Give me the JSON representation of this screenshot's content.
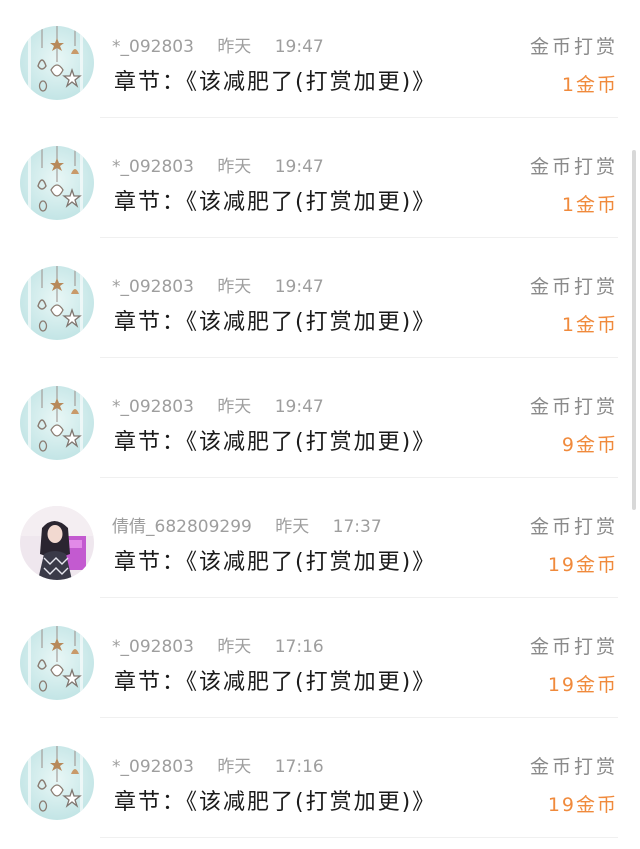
{
  "colors": {
    "amount": "#f08a3c",
    "meta": "#9e9e9e",
    "text": "#1a1a1a"
  },
  "rewards": [
    {
      "avatar": "star-bell-avatar",
      "username": "*_092803",
      "day": "昨天",
      "time": "19:47",
      "chapter_prefix": "章节：",
      "chapter_title": "《该减肥了(打赏加更)》",
      "reward_label": "金币打赏",
      "amount": "1金币"
    },
    {
      "avatar": "star-bell-avatar",
      "username": "*_092803",
      "day": "昨天",
      "time": "19:47",
      "chapter_prefix": "章节：",
      "chapter_title": "《该减肥了(打赏加更)》",
      "reward_label": "金币打赏",
      "amount": "1金币"
    },
    {
      "avatar": "star-bell-avatar",
      "username": "*_092803",
      "day": "昨天",
      "time": "19:47",
      "chapter_prefix": "章节：",
      "chapter_title": "《该减肥了(打赏加更)》",
      "reward_label": "金币打赏",
      "amount": "1金币"
    },
    {
      "avatar": "star-bell-avatar",
      "username": "*_092803",
      "day": "昨天",
      "time": "19:47",
      "chapter_prefix": "章节：",
      "chapter_title": "《该减肥了(打赏加更)》",
      "reward_label": "金币打赏",
      "amount": "9金币"
    },
    {
      "avatar": "girl-photo-avatar",
      "username": "倩倩_682809299",
      "day": "昨天",
      "time": "17:37",
      "chapter_prefix": "章节：",
      "chapter_title": "《该减肥了(打赏加更)》",
      "reward_label": "金币打赏",
      "amount": "19金币"
    },
    {
      "avatar": "star-bell-avatar",
      "username": "*_092803",
      "day": "昨天",
      "time": "17:16",
      "chapter_prefix": "章节：",
      "chapter_title": "《该减肥了(打赏加更)》",
      "reward_label": "金币打赏",
      "amount": "19金币"
    },
    {
      "avatar": "star-bell-avatar",
      "username": "*_092803",
      "day": "昨天",
      "time": "17:16",
      "chapter_prefix": "章节：",
      "chapter_title": "《该减肥了(打赏加更)》",
      "reward_label": "金币打赏",
      "amount": "19金币"
    }
  ]
}
